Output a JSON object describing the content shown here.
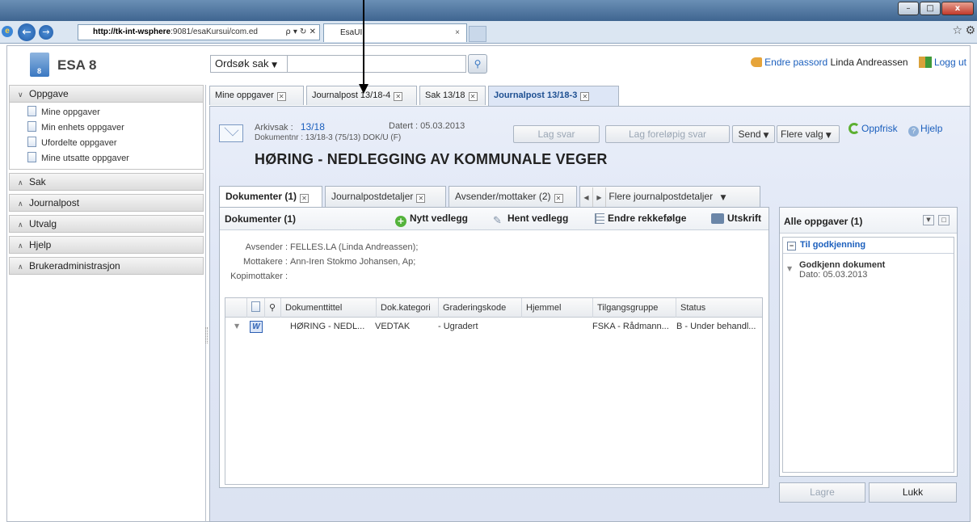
{
  "browser": {
    "url_host": "http://tk-int-wsphere",
    "url_rest": ":9081/esaKursui/com.ed",
    "url_tools": "ρ ▾ ↻ ✕",
    "tab_title": "EsaUI",
    "tab_close": "×"
  },
  "window": {
    "minimize": "–",
    "maximize": "□",
    "close": "x"
  },
  "app": {
    "title": "ESA 8",
    "logo_digit": "8"
  },
  "search": {
    "type_label": "Ordsøk sak",
    "value": ""
  },
  "topbar": {
    "change_password": "Endre passord",
    "user": "Linda Andreassen",
    "logout": "Logg ut"
  },
  "leftnav": {
    "oppgave": {
      "label": "Oppgave",
      "items": [
        "Mine oppgaver",
        "Min enhets oppgaver",
        "Ufordelte oppgaver",
        "Mine utsatte oppgaver"
      ]
    },
    "sections": [
      "Sak",
      "Journalpost",
      "Utvalg",
      "Hjelp",
      "Brukeradministrasjon"
    ]
  },
  "main_tabs": [
    "Mine oppgaver",
    "Journalpost 13/18-4",
    "Sak 13/18",
    "Journalpost 13/18-3"
  ],
  "journalpost": {
    "arkivsak_label": "Arkivsak :",
    "arkivsak": "13/18",
    "datert_label": "Datert :",
    "datert": "05.03.2013",
    "dokumentnr_label": "Dokumentnr :",
    "dokumentnr": "13/18-3 (75/13) DOK/U (F)",
    "title": "HØRING - NEDLEGGING AV KOMMUNALE VEGER"
  },
  "actions": {
    "lag_svar": "Lag svar",
    "lag_forelopig_svar": "Lag foreløpig svar",
    "send": "Send",
    "flere_valg": "Flere valg",
    "oppfrisk": "Oppfrisk",
    "hjelp": "Hjelp"
  },
  "sub_tabs": [
    "Dokumenter (1)",
    "Journalpostdetaljer",
    "Avsender/mottaker (2)",
    "Flere journalpostdetaljer"
  ],
  "documents": {
    "header": "Dokumenter (1)",
    "nytt_vedlegg": "Nytt vedlegg",
    "hent_vedlegg": "Hent vedlegg",
    "endre_rekkefolge": "Endre rekkefølge",
    "utskrift": "Utskrift",
    "avsender_label": "Avsender :",
    "avsender": "FELLES.LA (Linda Andreassen);",
    "mottakere_label": "Mottakere :",
    "mottakere": "Ann-Iren Stokmo Johansen, Ap;",
    "kopimottaker_label": "Kopimottaker :",
    "kopimottaker": "",
    "columns": [
      "Dokumenttittel",
      "Dok.kategori",
      "Graderingskode",
      "Hjemmel",
      "Tilgangsgruppe",
      "Status"
    ],
    "rows": [
      {
        "tittel": "HØRING - NEDL...",
        "kategori": "VEDTAK",
        "gradering": "- Ugradert",
        "hjemmel": "",
        "tilgang": "FSKA - Rådmann...",
        "status": "B - Under behandl..."
      }
    ]
  },
  "tasks": {
    "header": "Alle oppgaver (1)",
    "group": "Til godkjenning",
    "items": [
      {
        "name": "Godkjenn dokument",
        "date": "Dato: 05.03.2013"
      }
    ]
  },
  "footer": {
    "lagre": "Lagre",
    "lukk": "Lukk"
  }
}
